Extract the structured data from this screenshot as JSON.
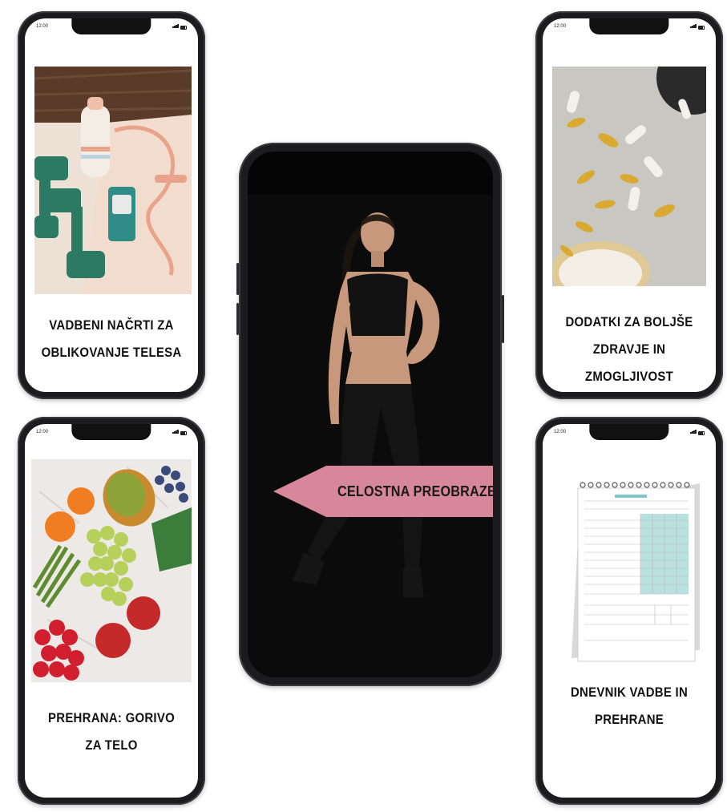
{
  "status_time": "12:00",
  "cards": {
    "top_left": {
      "caption_line1": "VADBENI NAČRTI ZA",
      "caption_line2": "OBLIKOVANJE TELESA"
    },
    "top_right": {
      "caption_line1": "DODATKI ZA BOLJŠE",
      "caption_line2": "ZDRAVJE IN ZMOGLJIVOST"
    },
    "bottom_left": {
      "caption_line1": "PREHRANA: GORIVO",
      "caption_line2": "ZA TELO"
    },
    "bottom_right": {
      "caption_line1": "DNEVNIK VADBE IN",
      "caption_line2": "PREHRANE"
    }
  },
  "center": {
    "banner_label": "CELOSTNA PREOBRAZBA"
  },
  "colors": {
    "banner": "#d6889a",
    "phone_frame": "#1c1c1e",
    "teal_accent": "#7ec9c6",
    "dumbbell": "#2d7a64"
  },
  "icons": [
    "signal-icon",
    "wifi-icon",
    "battery-icon"
  ]
}
